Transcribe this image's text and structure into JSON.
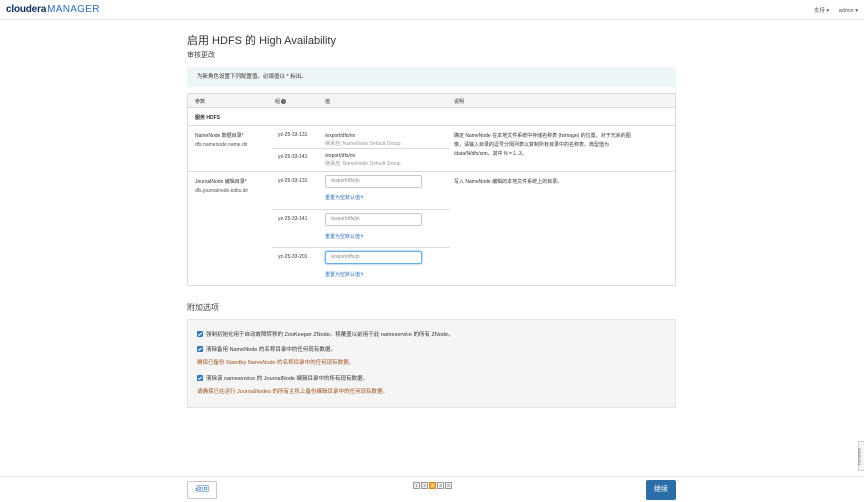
{
  "header": {
    "logo_brand": "cloudera",
    "logo_product": "MANAGER",
    "nav_support": "支持 ▾",
    "nav_user": "admin ▾"
  },
  "page": {
    "title": "启用 HDFS 的 High Availability",
    "section": "审核更改",
    "notice": "为新角色设置下列配置值。必填值以 * 标出。"
  },
  "table": {
    "headers": {
      "param": "参数",
      "group": "组",
      "value": "值",
      "desc": "说明"
    },
    "service": "服务 HDFS",
    "namenode": {
      "label": "NameNode 数据目录*",
      "key": "dfs.namenode.name.dir",
      "desc": "确定 NameNode 在本地文件系统中存储名称表 (fsimage) 的位置。对于冗余的图像，请输入目录的逗号分隔列表以复制所有目录中的名称表。典型值为 /data/N/dfs/snn，其中 N = 1..3。",
      "rows": [
        {
          "group": "yz-25-33-131",
          "value": "/export/dfs/nn",
          "inherited": "继承自:  NameNode Default Group"
        },
        {
          "group": "yz-25-33-141",
          "value": "/export/dfs/nn",
          "inherited": "继承自:  NameNode Default Group"
        }
      ]
    },
    "journalnode": {
      "label": "JournalNode 编辑目录*",
      "key": "dfs.journalnode.edits.dir",
      "desc": "写入 NameNode 编辑的本地文件系统上的目录。",
      "reset_label": "重置为空默认值↰",
      "rows": [
        {
          "group": "yz-25-33-131",
          "placeholder": "/export/dfs/jn"
        },
        {
          "group": "yz-25-33-141",
          "placeholder": "/export/dfs/jn"
        },
        {
          "group": "yz-25-33-201",
          "placeholder": "/export/dfs/jn"
        }
      ]
    }
  },
  "extra": {
    "title": "附加选项",
    "opt1": "强制初始化用于自动故障转移的 ZooKeeper ZNode。将覆盖以前用于此 nameservice 的所有 ZNode。",
    "opt2": "清除备用 NameNode 的名称目录中的任何现有数据。",
    "warn2": "确保已备份 Standby NameNode 的名称目录中的任何现有数据。",
    "opt3": "清除该 nameservice 的 JournalNode 编辑目录中的所有现有数据。",
    "warn3": "请确保已在运行 JournalNodes 的所有主机上备份编辑目录中的任何现有数据。"
  },
  "footer": {
    "back": "返回",
    "continue": "继续",
    "steps": [
      "1",
      "2",
      "3",
      "4",
      "5"
    ],
    "current_step": 3
  },
  "feedback": "Feedback"
}
